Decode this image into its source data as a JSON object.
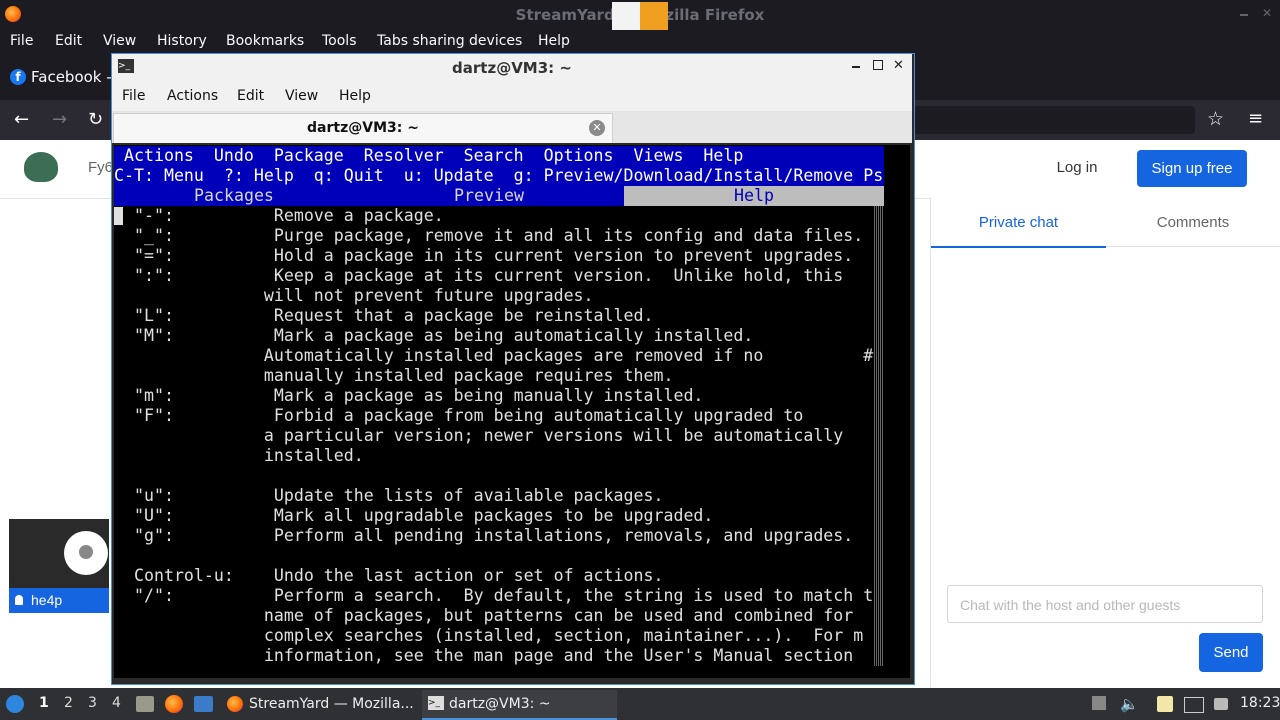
{
  "firefox": {
    "title": "StreamYard — Mozilla Firefox",
    "menu": [
      "File",
      "Edit",
      "View",
      "History",
      "Bookmarks",
      "Tools",
      "Tabs sharing devices",
      "Help"
    ],
    "tab_label": "Facebook - l"
  },
  "site": {
    "partial_title": "Fy6",
    "login": "Log in",
    "signup": "Sign up free",
    "tabs": [
      "Private chat",
      "Comments"
    ],
    "chat_placeholder": "Chat with the host and other guests",
    "send": "Send",
    "guest_name": "he4p"
  },
  "terminal": {
    "title": "dartz@VM3: ~",
    "menu": [
      "File",
      "Actions",
      "Edit",
      "View",
      "Help"
    ],
    "tab_title": "dartz@VM3: ~",
    "aptitude": {
      "menu_line": " Actions  Undo  Package  Resolver  Search  Options  Views  Help",
      "keys_line": "C-T: Menu  ?: Help  q: Quit  u: Update  g: Preview/Download/Install/Remove Ps",
      "tab_packages": "Packages",
      "tab_preview": "Preview",
      "tab_help": "Help",
      "help_lines": [
        "  \"-\":          Remove a package.",
        "  \"_\":          Purge package, remove it and all its config and data files.",
        "  \"=\":          Hold a package in its current version to prevent upgrades.",
        "  \":\":          Keep a package at its current version.  Unlike hold, this",
        "               will not prevent future upgrades.",
        "  \"L\":          Request that a package be reinstalled.",
        "  \"M\":          Mark a package as being automatically installed.",
        "               Automatically installed packages are removed if no          #",
        "               manually installed package requires them.",
        "  \"m\":          Mark a package as being manually installed.",
        "  \"F\":          Forbid a package from being automatically upgraded to",
        "               a particular version; newer versions will be automatically",
        "               installed.",
        "",
        "  \"u\":          Update the lists of available packages.",
        "  \"U\":          Mark all upgradable packages to be upgraded.",
        "  \"g\":          Perform all pending installations, removals, and upgrades.",
        "",
        "  Control-u:    Undo the last action or set of actions.",
        "  \"/\":          Perform a search.  By default, the string is used to match t",
        "               name of packages, but patterns can be used and combined for",
        "               complex searches (installed, section, maintainer...).  For m",
        "               information, see the man page and the User's Manual section"
      ]
    }
  },
  "taskbar": {
    "workspaces": [
      "1",
      "2",
      "3",
      "4"
    ],
    "tasks": [
      "StreamYard — Mozilla...",
      "dartz@VM3: ~"
    ],
    "clock": "18:23"
  }
}
